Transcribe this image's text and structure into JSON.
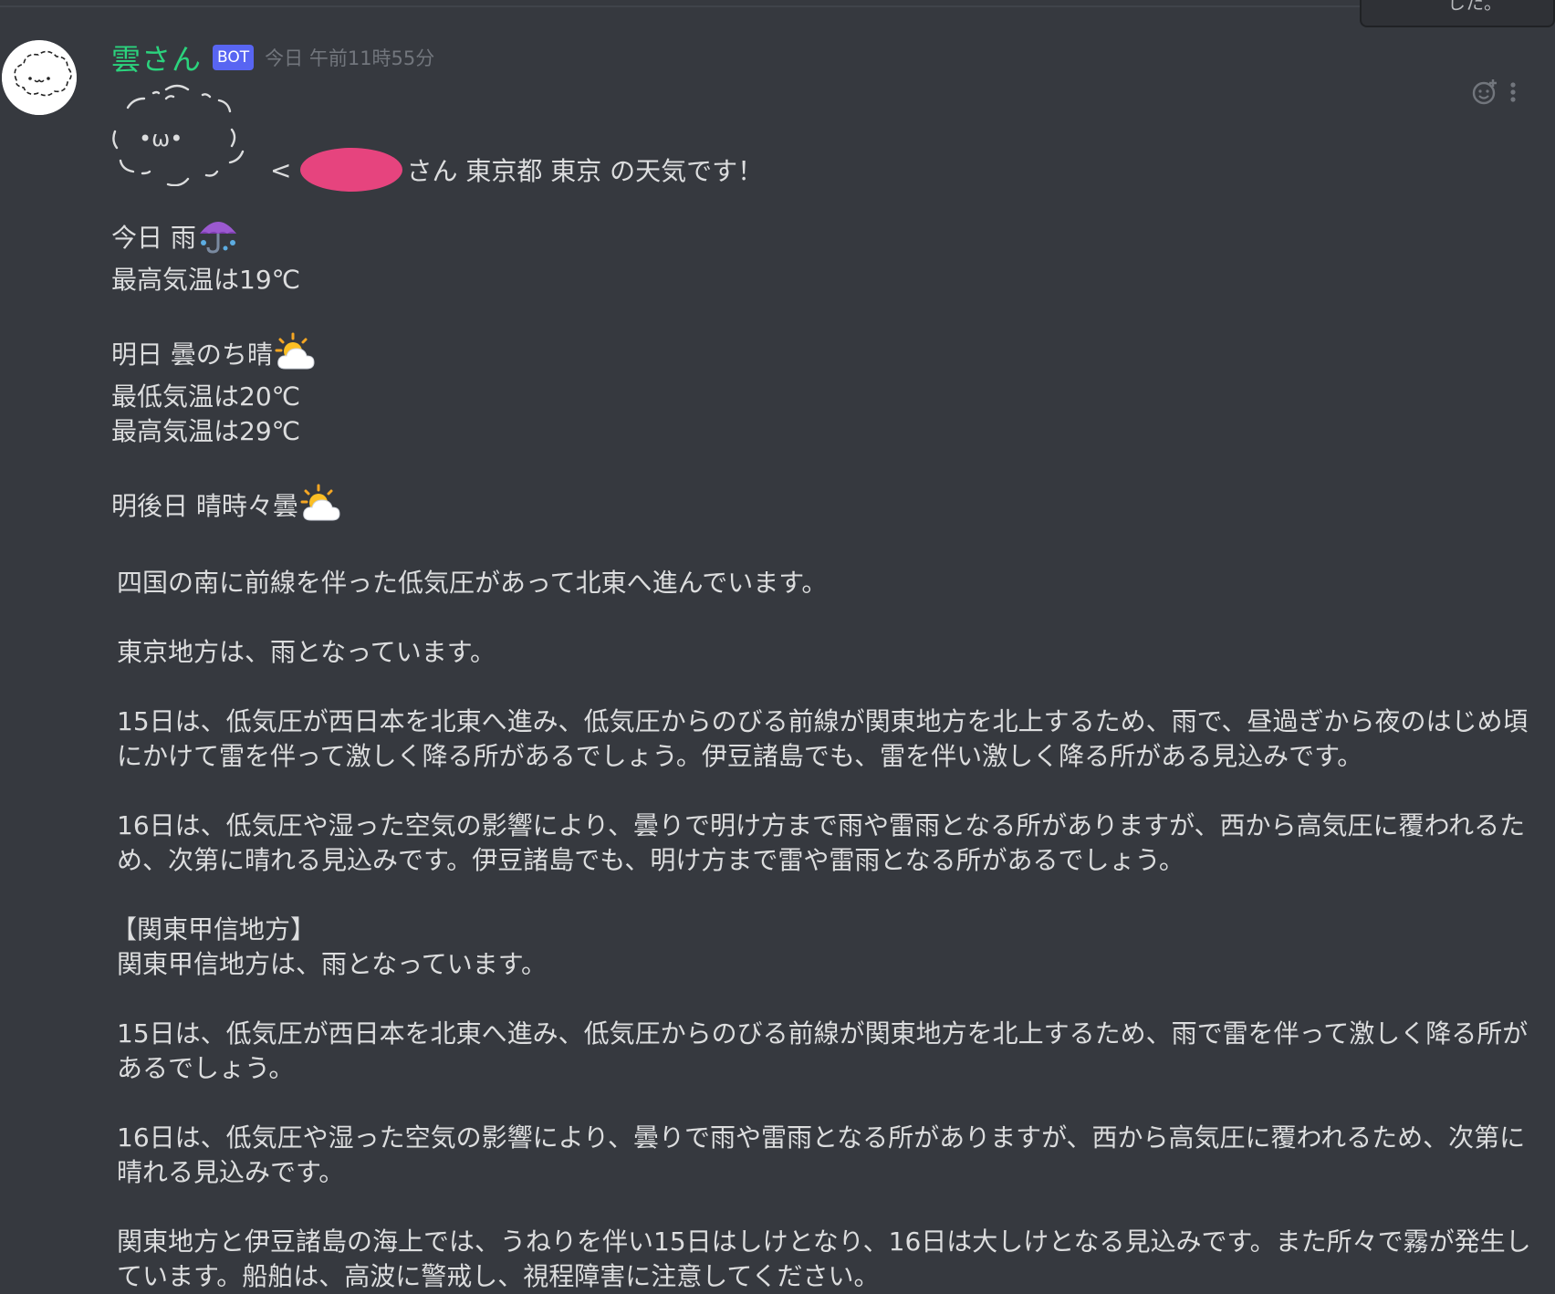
{
  "tooltip": {
    "text": "した。"
  },
  "message": {
    "author": "雲さん",
    "badge": "BOT",
    "timestamp": "今日 午前11時55分",
    "kaomoji_face": "•ω•",
    "greeting": {
      "prefix": "<",
      "suffix": "さん 東京都 東京 の天気です！"
    },
    "today": {
      "label": "今日 雨",
      "emoji": "umbrella-rain-icon",
      "high": "最高気温は19℃"
    },
    "tomorrow": {
      "label": "明日 曇のち晴",
      "emoji": "sun-behind-cloud-icon",
      "low": "最低気温は20℃",
      "high": "最高気温は29℃"
    },
    "day_after": {
      "label": "明後日 晴時々曇",
      "emoji": "sun-behind-cloud-icon"
    },
    "paragraphs": [
      "四国の南に前線を伴った低気圧があって北東へ進んでいます。",
      "東京地方は、雨となっています。",
      "15日は、低気圧が西日本を北東へ進み、低気圧からのびる前線が関東地方を北上するため、雨で、昼過ぎから夜のはじめ頃にかけて雷を伴って激しく降る所があるでしょう。伊豆諸島でも、雷を伴い激しく降る所がある見込みです。",
      "16日は、低気圧や湿った空気の影響により、曇りで明け方まで雨や雷雨となる所がありますが、西から高気圧に覆われるため、次第に晴れる見込みです。伊豆諸島でも、明け方まで雷や雷雨となる所があるでしょう。"
    ],
    "section_heading": "【関東甲信地方】",
    "section_paragraphs": [
      "関東甲信地方は、雨となっています。",
      "15日は、低気圧が西日本を北東へ進み、低気圧からのびる前線が関東地方を北上するため、雨で雷を伴って激しく降る所があるでしょう。",
      "16日は、低気圧や湿った空気の影響により、曇りで雨や雷雨となる所がありますが、西から高気圧に覆われるため、次第に晴れる見込みです。",
      "関東地方と伊豆諸島の海上では、うねりを伴い15日はしけとなり、16日は大しけとなる見込みです。また所々で霧が発生しています。船舶は、高波に警戒し、視程障害に注意してください。"
    ]
  },
  "colors": {
    "background": "#36393f",
    "author": "#2bd37d",
    "badge": "#5865f2",
    "text": "#dcddde",
    "timestamp": "#72767d",
    "redaction": "#e6447e"
  }
}
